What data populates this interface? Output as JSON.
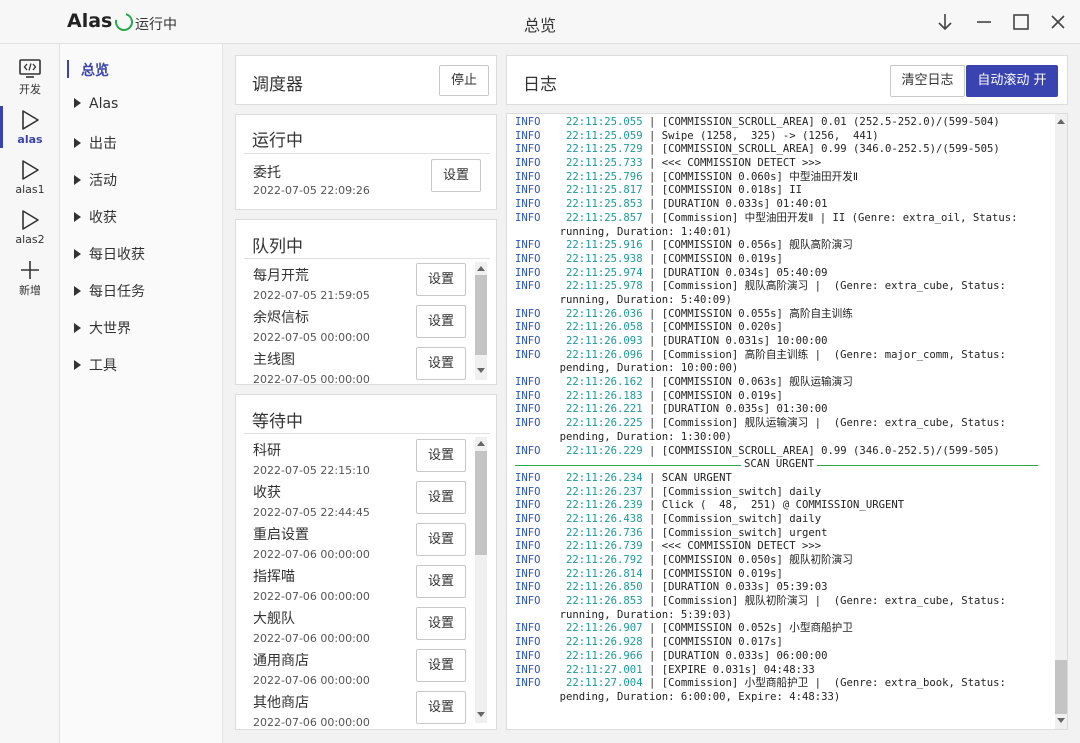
{
  "app": {
    "name": "Alas",
    "status": "运行中",
    "window_title": "总览"
  },
  "rail": [
    {
      "label": "开发",
      "icon": "code-icon"
    },
    {
      "label": "alas",
      "icon": "play-icon",
      "active": true
    },
    {
      "label": "alas1",
      "icon": "play-icon"
    },
    {
      "label": "alas2",
      "icon": "play-icon"
    },
    {
      "label": "新增",
      "icon": "plus-icon"
    }
  ],
  "menu": {
    "overview": "总览",
    "items": [
      "Alas",
      "出击",
      "活动",
      "收获",
      "每日收获",
      "每日任务",
      "大世界",
      "工具"
    ]
  },
  "scheduler": {
    "title": "调度器",
    "stop_label": "停止"
  },
  "running": {
    "title": "运行中",
    "task": {
      "name": "委托",
      "time": "2022-07-05 22:09:26"
    },
    "setting_label": "设置"
  },
  "queue": {
    "title": "队列中",
    "items": [
      {
        "name": "每月开荒",
        "time": "2022-07-05 21:59:05"
      },
      {
        "name": "余烬信标",
        "time": "2022-07-05 00:00:00"
      },
      {
        "name": "主线图",
        "time": "2022-07-05 00:00:00"
      }
    ],
    "setting_label": "设置"
  },
  "waiting": {
    "title": "等待中",
    "items": [
      {
        "name": "科研",
        "time": "2022-07-05 22:15:10"
      },
      {
        "name": "收获",
        "time": "2022-07-05 22:44:45"
      },
      {
        "name": "重启设置",
        "time": "2022-07-06 00:00:00"
      },
      {
        "name": "指挥喵",
        "time": "2022-07-06 00:00:00"
      },
      {
        "name": "大舰队",
        "time": "2022-07-06 00:00:00"
      },
      {
        "name": "通用商店",
        "time": "2022-07-06 00:00:00"
      },
      {
        "name": "其他商店",
        "time": "2022-07-06 00:00:00"
      }
    ],
    "setting_label": "设置"
  },
  "log": {
    "title": "日志",
    "clear_label": "清空日志",
    "autoscroll_label": "自动滚动 开",
    "lines": [
      {
        "level": "INFO",
        "time": "22:11:25.055",
        "msg": "[COMMISSION_SCROLL_AREA] 0.01 (252.5-252.0)/(599-504)"
      },
      {
        "level": "INFO",
        "time": "22:11:25.059",
        "msg": "Swipe (1258,  325) -> (1256,  441)"
      },
      {
        "level": "INFO",
        "time": "22:11:25.729",
        "msg": "[COMMISSION_SCROLL_AREA] 0.99 (346.0-252.5)/(599-505)"
      },
      {
        "level": "INFO",
        "time": "22:11:25.733",
        "msg": "<<< COMMISSION DETECT >>>"
      },
      {
        "level": "INFO",
        "time": "22:11:25.796",
        "msg": "[COMMISSION 0.060s] 中型油田开发Ⅱ"
      },
      {
        "level": "INFO",
        "time": "22:11:25.817",
        "msg": "[COMMISSION 0.018s] II"
      },
      {
        "level": "INFO",
        "time": "22:11:25.853",
        "msg": "[DURATION 0.033s] 01:40:01"
      },
      {
        "level": "INFO",
        "time": "22:11:25.857",
        "msg": "[Commission] 中型油田开发Ⅱ | II (Genre: extra_oil, Status:"
      },
      {
        "cont": "running, Duration: 1:40:01)"
      },
      {
        "level": "INFO",
        "time": "22:11:25.916",
        "msg": "[COMMISSION 0.056s] 舰队高阶演习"
      },
      {
        "level": "INFO",
        "time": "22:11:25.938",
        "msg": "[COMMISSION 0.019s]"
      },
      {
        "level": "INFO",
        "time": "22:11:25.974",
        "msg": "[DURATION 0.034s] 05:40:09"
      },
      {
        "level": "INFO",
        "time": "22:11:25.978",
        "msg": "[Commission] 舰队高阶演习 |  (Genre: extra_cube, Status:"
      },
      {
        "cont": "running, Duration: 5:40:09)"
      },
      {
        "level": "INFO",
        "time": "22:11:26.036",
        "msg": "[COMMISSION 0.055s] 高阶自主训练"
      },
      {
        "level": "INFO",
        "time": "22:11:26.058",
        "msg": "[COMMISSION 0.020s]"
      },
      {
        "level": "INFO",
        "time": "22:11:26.093",
        "msg": "[DURATION 0.031s] 10:00:00"
      },
      {
        "level": "INFO",
        "time": "22:11:26.096",
        "msg": "[Commission] 高阶自主训练 |  (Genre: major_comm, Status:"
      },
      {
        "cont": "pending, Duration: 10:00:00)"
      },
      {
        "level": "INFO",
        "time": "22:11:26.162",
        "msg": "[COMMISSION 0.063s] 舰队运输演习"
      },
      {
        "level": "INFO",
        "time": "22:11:26.183",
        "msg": "[COMMISSION 0.019s]"
      },
      {
        "level": "INFO",
        "time": "22:11:26.221",
        "msg": "[DURATION 0.035s] 01:30:00"
      },
      {
        "level": "INFO",
        "time": "22:11:26.225",
        "msg": "[Commission] 舰队运输演习 |  (Genre: extra_cube, Status:"
      },
      {
        "cont": "pending, Duration: 1:30:00)"
      },
      {
        "level": "INFO",
        "time": "22:11:26.229",
        "msg": "[COMMISSION_SCROLL_AREA] 0.99 (346.0-252.5)/(599-505)"
      },
      {
        "rule": "SCAN URGENT"
      },
      {
        "level": "INFO",
        "time": "22:11:26.234",
        "msg": "SCAN URGENT"
      },
      {
        "level": "INFO",
        "time": "22:11:26.237",
        "msg": "[Commission_switch] daily"
      },
      {
        "level": "INFO",
        "time": "22:11:26.239",
        "msg": "Click (  48,  251) @ COMMISSION_URGENT"
      },
      {
        "level": "INFO",
        "time": "22:11:26.438",
        "msg": "[Commission_switch] daily"
      },
      {
        "level": "INFO",
        "time": "22:11:26.736",
        "msg": "[Commission_switch] urgent"
      },
      {
        "level": "INFO",
        "time": "22:11:26.739",
        "msg": "<<< COMMISSION DETECT >>>"
      },
      {
        "level": "INFO",
        "time": "22:11:26.792",
        "msg": "[COMMISSION 0.050s] 舰队初阶演习"
      },
      {
        "level": "INFO",
        "time": "22:11:26.814",
        "msg": "[COMMISSION 0.019s]"
      },
      {
        "level": "INFO",
        "time": "22:11:26.850",
        "msg": "[DURATION 0.033s] 05:39:03"
      },
      {
        "level": "INFO",
        "time": "22:11:26.853",
        "msg": "[Commission] 舰队初阶演习 |  (Genre: extra_cube, Status:"
      },
      {
        "cont": "running, Duration: 5:39:03)"
      },
      {
        "level": "INFO",
        "time": "22:11:26.907",
        "msg": "[COMMISSION 0.052s] 小型商船护卫"
      },
      {
        "level": "INFO",
        "time": "22:11:26.928",
        "msg": "[COMMISSION 0.017s]"
      },
      {
        "level": "INFO",
        "time": "22:11:26.966",
        "msg": "[DURATION 0.033s] 06:00:00"
      },
      {
        "level": "INFO",
        "time": "22:11:27.001",
        "msg": "[EXPIRE 0.031s] 04:48:33"
      },
      {
        "level": "INFO",
        "time": "22:11:27.004",
        "msg": "[Commission] 小型商船护卫 |  (Genre: extra_book, Status:"
      },
      {
        "cont": "pending, Duration: 6:00:00, Expire: 4:48:33)"
      }
    ]
  },
  "colors": {
    "accent": "#3a44b0",
    "running_green": "#27a84a",
    "log_level": "#2b55c9",
    "log_time": "#1a9a9a"
  }
}
